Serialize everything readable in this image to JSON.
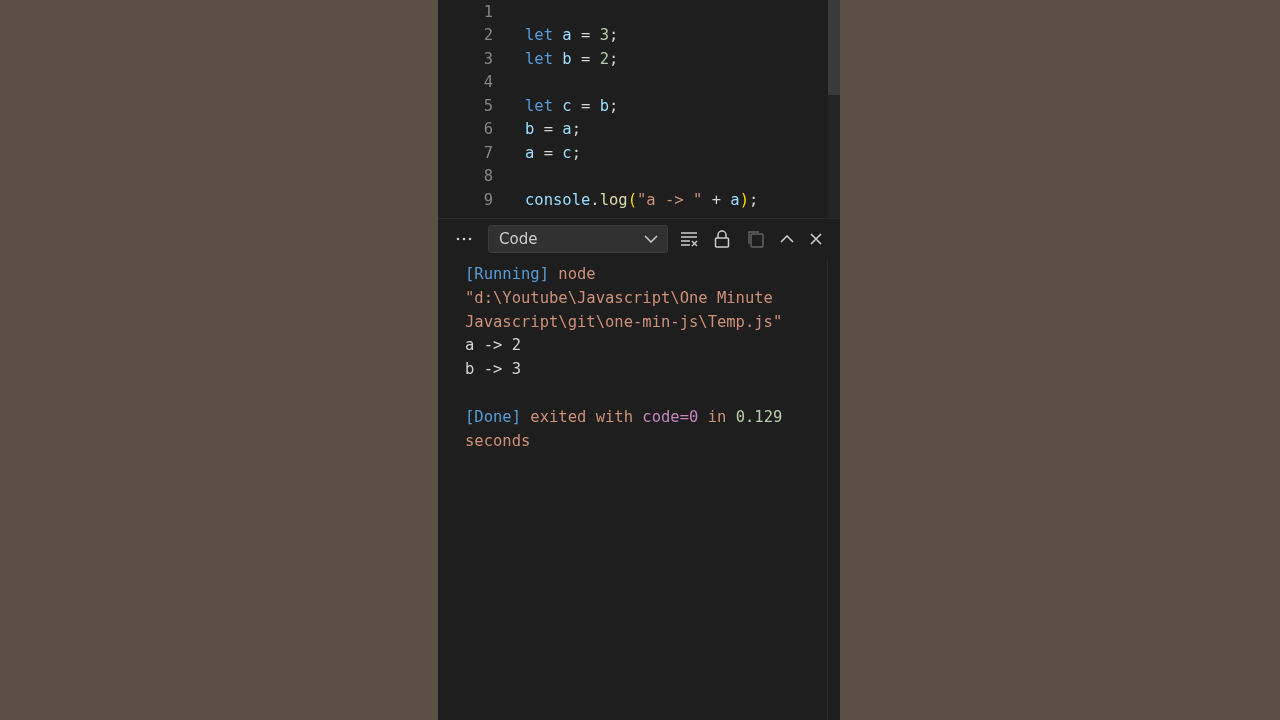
{
  "editor": {
    "lines": [
      {
        "number": "1"
      },
      {
        "number": "2",
        "tokens": [
          {
            "kind": "keyword",
            "text": "let "
          },
          {
            "kind": "variable",
            "text": "a"
          },
          {
            "kind": "punct",
            "text": " = "
          },
          {
            "kind": "number",
            "text": "3"
          },
          {
            "kind": "punct",
            "text": ";"
          }
        ]
      },
      {
        "number": "3",
        "tokens": [
          {
            "kind": "keyword",
            "text": "let "
          },
          {
            "kind": "variable",
            "text": "b"
          },
          {
            "kind": "punct",
            "text": " = "
          },
          {
            "kind": "number",
            "text": "2"
          },
          {
            "kind": "punct",
            "text": ";"
          }
        ]
      },
      {
        "number": "4"
      },
      {
        "number": "5",
        "tokens": [
          {
            "kind": "keyword",
            "text": "let "
          },
          {
            "kind": "variable",
            "text": "c"
          },
          {
            "kind": "punct",
            "text": " = "
          },
          {
            "kind": "variable",
            "text": "b"
          },
          {
            "kind": "punct",
            "text": ";"
          }
        ]
      },
      {
        "number": "6",
        "tokens": [
          {
            "kind": "variable",
            "text": "b"
          },
          {
            "kind": "punct",
            "text": " = "
          },
          {
            "kind": "variable",
            "text": "a"
          },
          {
            "kind": "punct",
            "text": ";"
          }
        ]
      },
      {
        "number": "7",
        "tokens": [
          {
            "kind": "variable",
            "text": "a"
          },
          {
            "kind": "punct",
            "text": " = "
          },
          {
            "kind": "variable",
            "text": "c"
          },
          {
            "kind": "punct",
            "text": ";"
          }
        ]
      },
      {
        "number": "8"
      },
      {
        "number": "9",
        "tokens": [
          {
            "kind": "variable",
            "text": "console"
          },
          {
            "kind": "punct",
            "text": "."
          },
          {
            "kind": "function",
            "text": "log"
          },
          {
            "kind": "bracket",
            "text": "("
          },
          {
            "kind": "string",
            "text": "\"a -> \""
          },
          {
            "kind": "punct",
            "text": " + "
          },
          {
            "kind": "variable",
            "text": "a"
          },
          {
            "kind": "bracket",
            "text": ")"
          },
          {
            "kind": "punct",
            "text": ";"
          }
        ]
      }
    ]
  },
  "output_panel": {
    "dropdown": {
      "value": "Code"
    },
    "toolbar": [
      {
        "kind": "clear",
        "disabled": false
      },
      {
        "kind": "lock",
        "disabled": false
      },
      {
        "kind": "copy",
        "disabled": true
      },
      {
        "kind": "up",
        "disabled": false
      },
      {
        "kind": "close",
        "disabled": false
      }
    ],
    "lines": [
      {
        "tokens": [
          {
            "kind": "tag",
            "text": "[Running]"
          },
          {
            "kind": "string",
            "text": " node"
          }
        ]
      },
      {
        "tokens": [
          {
            "kind": "string",
            "text": "\"d:\\Youtube\\Javascript\\One Minute"
          }
        ]
      },
      {
        "tokens": [
          {
            "kind": "string",
            "text": "Javascript\\git\\one-min-js\\Temp.js\""
          }
        ]
      },
      {
        "tokens": [
          {
            "kind": "plain",
            "text": "a -> 2"
          }
        ]
      },
      {
        "tokens": [
          {
            "kind": "plain",
            "text": "b -> 3"
          }
        ]
      },
      {
        "kind": "blank"
      },
      {
        "tokens": [
          {
            "kind": "tag",
            "text": "[Done]"
          },
          {
            "kind": "string",
            "text": " exited with "
          },
          {
            "kind": "code",
            "text": "code=0"
          },
          {
            "kind": "string",
            "text": " in "
          },
          {
            "kind": "number",
            "text": "0.129"
          }
        ]
      },
      {
        "tokens": [
          {
            "kind": "string",
            "text": "seconds"
          }
        ]
      }
    ]
  }
}
